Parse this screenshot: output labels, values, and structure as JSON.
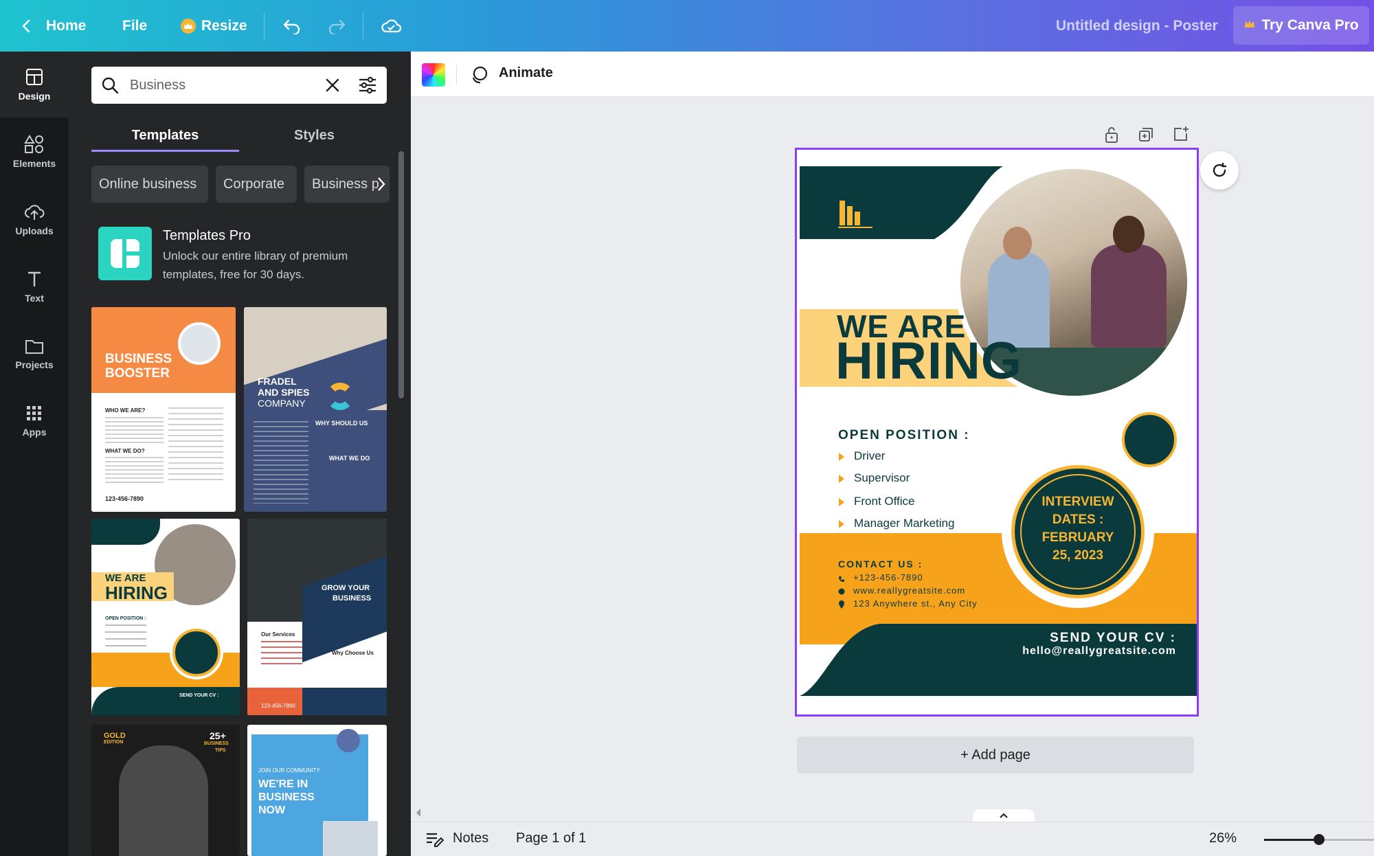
{
  "topbar": {
    "home": "Home",
    "file": "File",
    "resize": "Resize",
    "doc_title": "Untitled design - Poster",
    "try_pro": "Try Canva Pro"
  },
  "rail": {
    "items": [
      {
        "label": "Design",
        "icon": "layout-icon"
      },
      {
        "label": "Elements",
        "icon": "shapes-icon"
      },
      {
        "label": "Uploads",
        "icon": "cloud-upload-icon"
      },
      {
        "label": "Text",
        "icon": "text-icon"
      },
      {
        "label": "Projects",
        "icon": "folder-icon"
      },
      {
        "label": "Apps",
        "icon": "apps-grid-icon"
      }
    ]
  },
  "panel": {
    "search_value": "Business",
    "tabs": [
      "Templates",
      "Styles"
    ],
    "chips": [
      "Online business",
      "Corporate",
      "Business p"
    ],
    "promo_title": "Templates Pro",
    "promo_text_1": "Unlock our entire library of premium",
    "promo_text_2": "templates, free for 30 days."
  },
  "thumbs": {
    "t1_a": "BUSINESS",
    "t1_b": "BOOSTER",
    "t1_c": "WHO WE ARE?",
    "t1_d": "WHAT WE DO?",
    "t1_e": "123-456-7890",
    "t2_a": "FRADEL",
    "t2_b": "AND SPIES",
    "t2_c": "COMPANY",
    "t2_d": "WHY SHOULD US",
    "t2_e": "WHAT WE DO",
    "t3_a": "WE ARE",
    "t3_b": "HIRING",
    "t3_c": "OPEN POSITION :",
    "t3_d": "SEND YOUR CV :",
    "t4_a": "GROW YOUR",
    "t4_b": "BUSINESS",
    "t4_c": "Our Services",
    "t4_d": "Why Choose Us",
    "t4_e": "123-456-7890",
    "t5_a": "GOLD",
    "t5_b": "EDITION",
    "t5_c": "25+",
    "t5_d": "BUSINESS",
    "t5_e": "TIPS",
    "t6_a": "JOIN OUR COMMUNITY",
    "t6_b": "WE'RE IN",
    "t6_c": "BUSINESS",
    "t6_d": "NOW"
  },
  "editor": {
    "animate": "Animate",
    "add_page": "+ Add page",
    "notes": "Notes",
    "page_indicator": "Page 1 of 1",
    "zoom": "26%",
    "zoom_level": 0.26
  },
  "poster": {
    "we_are": "WE ARE",
    "hiring": "HIRING",
    "open_position": "OPEN POSITION :",
    "positions": [
      "Driver",
      "Supervisor",
      "Front Office",
      "Manager Marketing"
    ],
    "badge_1": "INTERVIEW",
    "badge_2": "DATES :",
    "badge_3": "FEBRUARY",
    "badge_4": "25, 2023",
    "contact_title": "CONTACT US :",
    "phone": "+123-456-7890",
    "website": "www.reallygreatsite.com",
    "address": "123 Anywhere st., Any City",
    "send_cv": "SEND YOUR CV :",
    "email": "hello@reallygreatsite.com"
  },
  "colors": {
    "accent": "#8b3dff",
    "poster_teal": "#0b3a3d",
    "poster_orange": "#f7a21b",
    "poster_yellow": "#fcd27a"
  }
}
